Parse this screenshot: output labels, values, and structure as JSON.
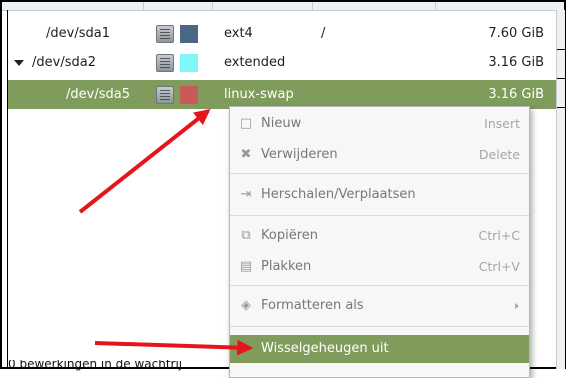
{
  "partitions": [
    {
      "device": "/dev/sda1",
      "fs": "ext4",
      "mount": "/",
      "size": "7.60 GiB",
      "color": "#4a6784",
      "expandable": false,
      "selected": false,
      "icon": "lock-icon"
    },
    {
      "device": "/dev/sda2",
      "fs": "extended",
      "mount": "",
      "size": "3.16 GiB",
      "color": "#7df7f7",
      "expandable": true,
      "selected": false,
      "icon": "lock-icon"
    },
    {
      "device": "/dev/sda5",
      "fs": "linux-swap",
      "mount": "",
      "size": "3.16 GiB",
      "color": "#c85a5a",
      "expandable": false,
      "selected": true,
      "icon": "lock-icon"
    }
  ],
  "context_menu": {
    "items": [
      {
        "label": "Nieuw",
        "shortcut": "Insert",
        "icon": "new-icon",
        "enabled": false
      },
      {
        "label": "Verwijderen",
        "shortcut": "Delete",
        "icon": "delete-icon",
        "enabled": false
      },
      {
        "label": "Herschalen/Verplaatsen",
        "shortcut": "",
        "icon": "resize-icon",
        "enabled": false
      },
      {
        "label": "Kopiëren",
        "shortcut": "Ctrl+C",
        "icon": "copy-icon",
        "enabled": false
      },
      {
        "label": "Plakken",
        "shortcut": "Ctrl+V",
        "icon": "paste-icon",
        "enabled": false
      },
      {
        "label": "Formatteren als",
        "shortcut": "",
        "icon": "format-icon",
        "enabled": false,
        "submenu": true
      },
      {
        "label": "Wisselgeheugen uit",
        "shortcut": "",
        "icon": "",
        "enabled": true,
        "highlighted": true
      }
    ]
  },
  "status_bar": {
    "text": "0 bewerkingen in de wachtrij"
  },
  "colors": {
    "selection": "#7f9c5c",
    "annotation_arrow": "#e8141c"
  }
}
